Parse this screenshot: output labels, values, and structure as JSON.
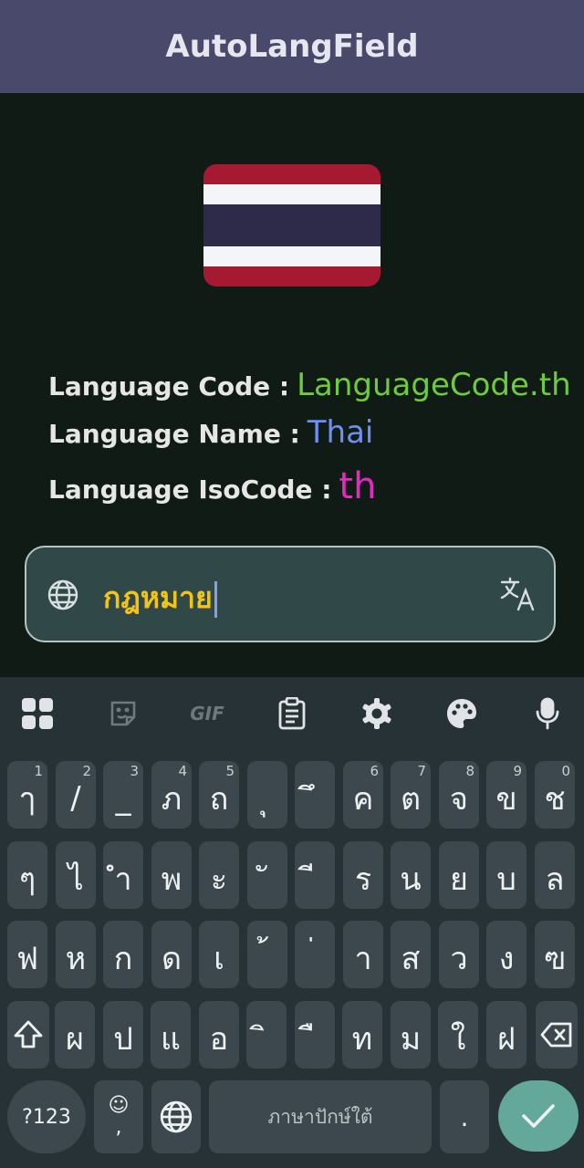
{
  "app": {
    "title": "AutoLangField"
  },
  "flag": {
    "country": "thailand-flag",
    "colors": [
      "#a51931",
      "#f4f5f8",
      "#2d2a4a",
      "#f4f5f8",
      "#a51931"
    ]
  },
  "info": {
    "code_label": "Language Code :",
    "code_value": "LanguageCode.th",
    "name_label": "Language Name :",
    "name_value": "Thai",
    "iso_label": "Language IsoCode :",
    "iso_value": "th"
  },
  "field": {
    "value": "กฎหมาย",
    "leading_icon": "globe-icon",
    "trailing_icon": "translate-icon"
  },
  "keyboard": {
    "toolbar": [
      "apps-icon",
      "sticker-icon",
      "gif-icon",
      "clipboard-icon",
      "gear-icon",
      "palette-icon",
      "mic-icon"
    ],
    "gif_label": "GIF",
    "rows": [
      [
        {
          "k": "ๅ",
          "h": "1"
        },
        {
          "k": "/",
          "h": "2"
        },
        {
          "k": "_",
          "h": "3"
        },
        {
          "k": "ภ",
          "h": "4"
        },
        {
          "k": "ถ",
          "h": "5"
        },
        {
          "k": "ุ",
          "h": ""
        },
        {
          "k": "ึ",
          "h": ""
        },
        {
          "k": "ค",
          "h": "6"
        },
        {
          "k": "ต",
          "h": "7"
        },
        {
          "k": "จ",
          "h": "8"
        },
        {
          "k": "ข",
          "h": "9"
        },
        {
          "k": "ช",
          "h": "0"
        }
      ],
      [
        {
          "k": "ๆ",
          "h": ""
        },
        {
          "k": "ไ",
          "h": ""
        },
        {
          "k": "ำ",
          "h": ""
        },
        {
          "k": "พ",
          "h": ""
        },
        {
          "k": "ะ",
          "h": ""
        },
        {
          "k": "ั",
          "h": ""
        },
        {
          "k": "ี",
          "h": ""
        },
        {
          "k": "ร",
          "h": ""
        },
        {
          "k": "น",
          "h": ""
        },
        {
          "k": "ย",
          "h": ""
        },
        {
          "k": "บ",
          "h": ""
        },
        {
          "k": "ล",
          "h": ""
        }
      ],
      [
        {
          "k": "ฟ",
          "h": ""
        },
        {
          "k": "ห",
          "h": ""
        },
        {
          "k": "ก",
          "h": ""
        },
        {
          "k": "ด",
          "h": ""
        },
        {
          "k": "เ",
          "h": ""
        },
        {
          "k": "้",
          "h": ""
        },
        {
          "k": "่",
          "h": ""
        },
        {
          "k": "า",
          "h": ""
        },
        {
          "k": "ส",
          "h": ""
        },
        {
          "k": "ว",
          "h": ""
        },
        {
          "k": "ง",
          "h": ""
        },
        {
          "k": "ฃ",
          "h": ""
        }
      ],
      [
        {
          "k": "ผ",
          "h": ""
        },
        {
          "k": "ป",
          "h": ""
        },
        {
          "k": "แ",
          "h": ""
        },
        {
          "k": "อ",
          "h": ""
        },
        {
          "k": "ิ",
          "h": ""
        },
        {
          "k": "ื",
          "h": ""
        },
        {
          "k": "ท",
          "h": ""
        },
        {
          "k": "ม",
          "h": ""
        },
        {
          "k": "ใ",
          "h": ""
        },
        {
          "k": "ฝ",
          "h": ""
        }
      ]
    ],
    "sym_label": "?123",
    "emoji_top": "☺",
    "emoji_bottom": ",",
    "space_label": "ภาษาปักษ์ใต้",
    "period_label": "."
  }
}
